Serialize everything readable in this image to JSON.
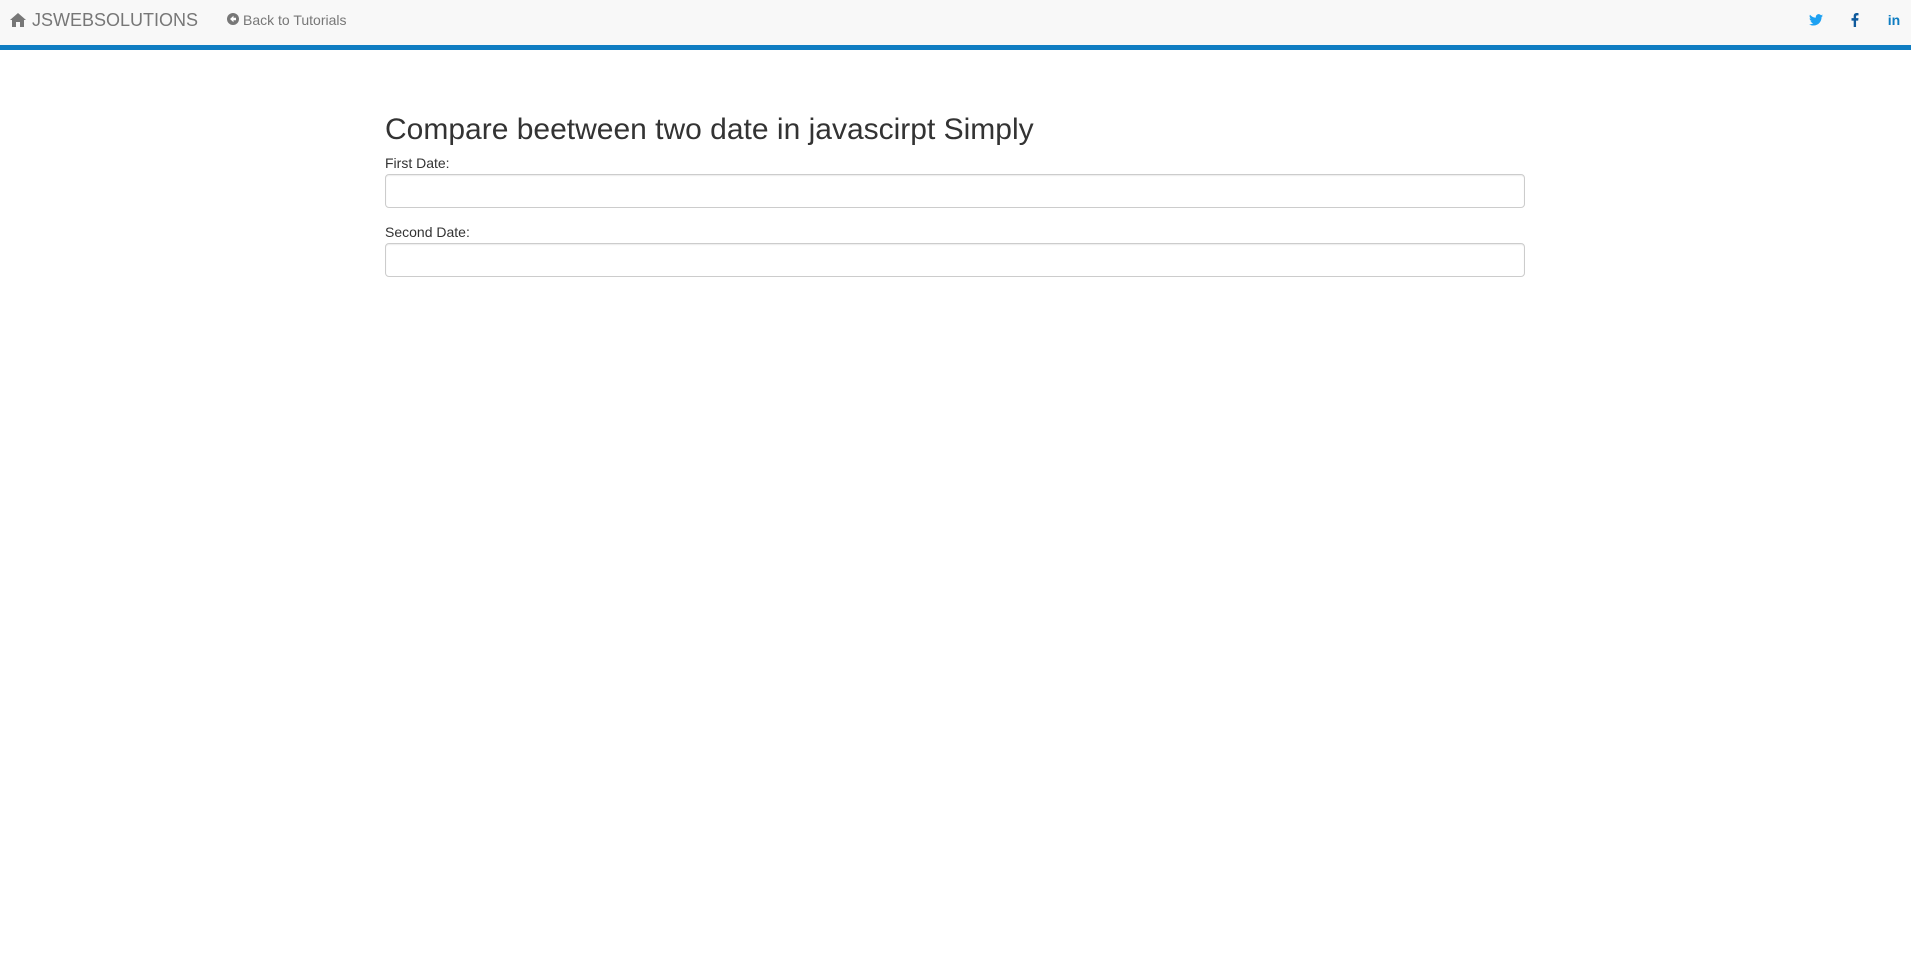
{
  "navbar": {
    "brand_label": "JSWEBSOLUTIONS",
    "brand_icon": "home-icon",
    "back_label": "Back to Tutorials",
    "back_icon": "arrow-circle-left-icon",
    "social": [
      {
        "name": "twitter-icon"
      },
      {
        "name": "facebook-icon"
      },
      {
        "name": "linkedin-icon",
        "label": "in"
      }
    ],
    "accent_color": "#0f7dc2"
  },
  "main": {
    "title": "Compare beetween two date in javascirpt Simply",
    "fields": [
      {
        "label": "First Date:",
        "value": ""
      },
      {
        "label": "Second Date:",
        "value": ""
      }
    ]
  }
}
